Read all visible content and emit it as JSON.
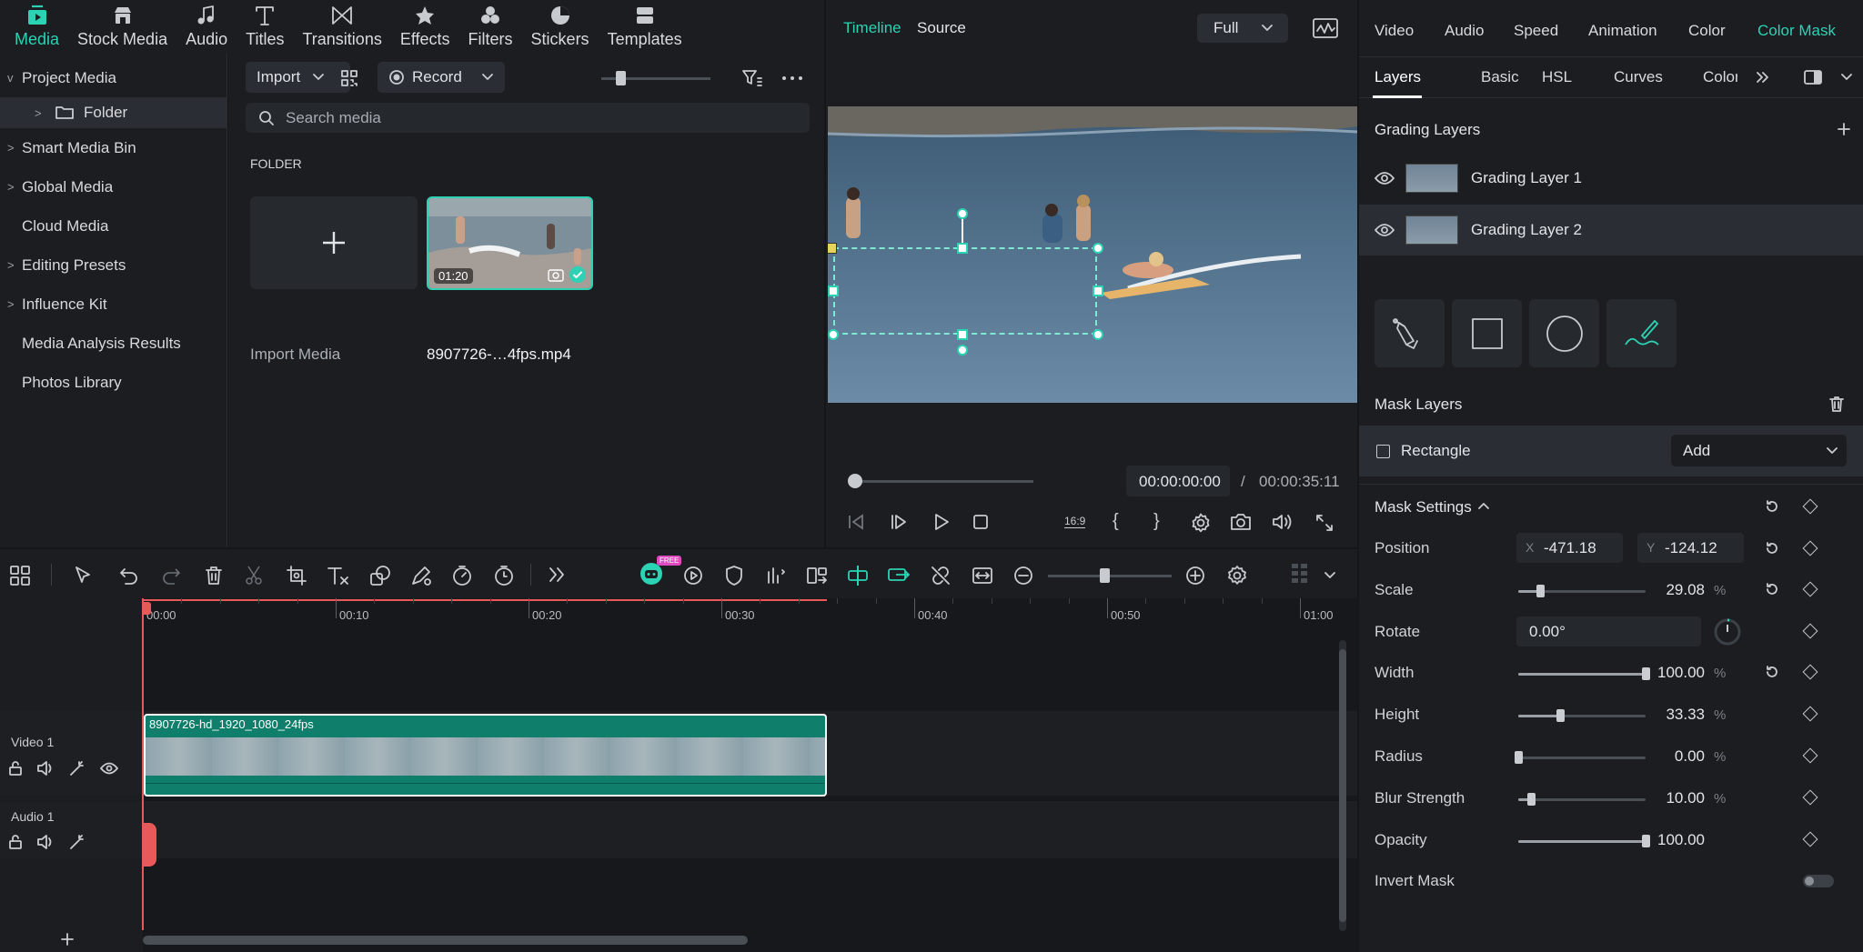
{
  "nav": {
    "tabs": [
      {
        "label": "Media",
        "icon": "media-icon",
        "active": true
      },
      {
        "label": "Stock Media",
        "icon": "stock-media-icon"
      },
      {
        "label": "Audio",
        "icon": "audio-icon"
      },
      {
        "label": "Titles",
        "icon": "titles-icon"
      },
      {
        "label": "Transitions",
        "icon": "transitions-icon"
      },
      {
        "label": "Effects",
        "icon": "effects-icon"
      },
      {
        "label": "Filters",
        "icon": "filters-icon"
      },
      {
        "label": "Stickers",
        "icon": "stickers-icon"
      },
      {
        "label": "Templates",
        "icon": "templates-icon"
      }
    ]
  },
  "tree": {
    "items": [
      {
        "label": "Project Media",
        "chevron": "v"
      },
      {
        "label": "Folder",
        "chevron": ">"
      },
      {
        "label": "Smart Media Bin",
        "chevron": ">"
      },
      {
        "label": "Global Media",
        "chevron": ">"
      },
      {
        "label": "Cloud Media",
        "chevron": ""
      },
      {
        "label": "Editing Presets",
        "chevron": ">"
      },
      {
        "label": "Influence Kit",
        "chevron": ">"
      },
      {
        "label": "Media Analysis Results",
        "chevron": ""
      },
      {
        "label": "Photos Library",
        "chevron": ""
      }
    ]
  },
  "media": {
    "import_label": "Import",
    "record_label": "Record",
    "search_placeholder": "Search media",
    "section_label": "FOLDER",
    "import_media_label": "Import Media",
    "clip": {
      "duration": "01:20",
      "name": "8907726-…4fps.mp4"
    }
  },
  "preview": {
    "tab_timeline": "Timeline",
    "tab_source": "Source",
    "quality": "Full",
    "current_time": "00:00:00:00",
    "separator": "/",
    "total_time": "00:00:35:11",
    "aspect": "16:9"
  },
  "right": {
    "tabs": [
      "Video",
      "Audio",
      "Speed",
      "Animation",
      "Color",
      "Color Mask"
    ],
    "subtabs": [
      "Layers",
      "Basic",
      "HSL",
      "Curves",
      "Color"
    ],
    "grading_title": "Grading Layers",
    "layers": [
      {
        "label": "Grading Layer 1"
      },
      {
        "label": "Grading Layer 2"
      }
    ],
    "mask_layers_title": "Mask Layers",
    "mask_item": "Rectangle",
    "add_label": "Add",
    "mask_settings_title": "Mask Settings",
    "position": {
      "label": "Position",
      "x_label": "X",
      "x": "-471.18",
      "y_label": "Y",
      "y": "-124.12"
    },
    "rotate": {
      "label": "Rotate",
      "value": "0.00°"
    },
    "sliders": [
      {
        "label": "Scale",
        "value": "29.08",
        "unit": "%",
        "level": 0.17,
        "reset": true
      },
      {
        "label": "Width",
        "value": "100.00",
        "unit": "%",
        "level": 1.0,
        "reset": true
      },
      {
        "label": "Height",
        "value": "33.33",
        "unit": "%",
        "level": 0.33,
        "reset": false
      },
      {
        "label": "Radius",
        "value": "0.00",
        "unit": "%",
        "level": 0.0,
        "reset": false
      },
      {
        "label": "Blur Strength",
        "value": "10.00",
        "unit": "%",
        "level": 0.1,
        "reset": false
      },
      {
        "label": "Opacity",
        "value": "100.00",
        "unit": "",
        "level": 1.0,
        "reset": false
      }
    ],
    "invert_label": "Invert Mask",
    "accent": "#2bd2b4"
  },
  "timeline": {
    "ruler": [
      "00:00",
      "00:10",
      "00:20",
      "00:30",
      "00:40",
      "00:50",
      "01:00"
    ],
    "video_track": "Video 1",
    "audio_track": "Audio 1",
    "clip_title": "8907726-hd_1920_1080_24fps",
    "ai_badge": "FREE"
  }
}
